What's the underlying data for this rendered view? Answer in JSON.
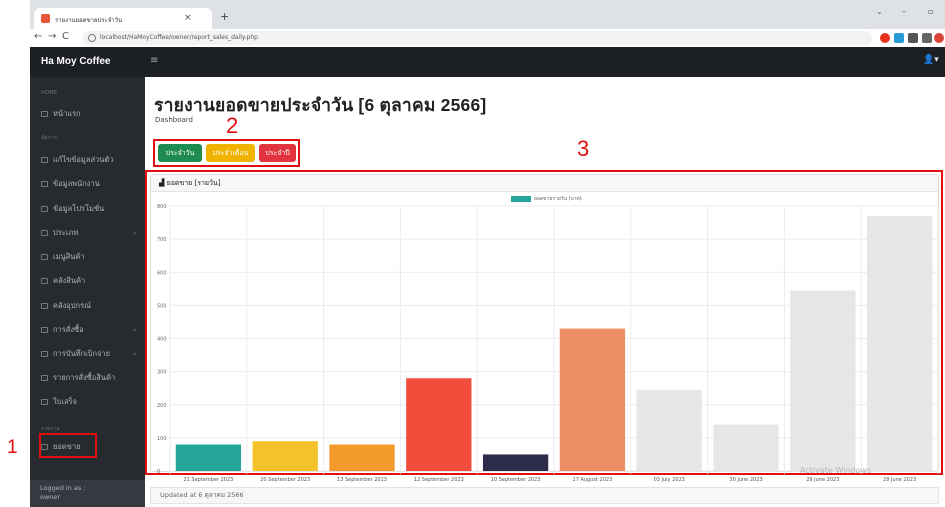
{
  "browser": {
    "tab_title": "รายงานยอดขายประจำวัน",
    "tab_close": "×",
    "new_tab": "+",
    "url": "localhost/HaMoyCoffee/owner/report_sales_daily.php"
  },
  "sidebar": {
    "brand": "Ha Moy Coffee",
    "sections": {
      "home": "HOME",
      "manage": "จัดการ",
      "report": "รายงาน"
    },
    "items": [
      {
        "label": "หน้าแรก",
        "icon": "home-icon",
        "chevron": false
      },
      {
        "label": "แก้ไขข้อมูลส่วนตัว",
        "icon": "user-edit-icon",
        "chevron": false
      },
      {
        "label": "ข้อมูลพนักงาน",
        "icon": "users-icon",
        "chevron": false
      },
      {
        "label": "ข้อมูลโปรโมชั่น",
        "icon": "promo-icon",
        "chevron": false
      },
      {
        "label": "ประเภท",
        "icon": "category-icon",
        "chevron": true
      },
      {
        "label": "เมนูสินค้า",
        "icon": "coffee-icon",
        "chevron": false
      },
      {
        "label": "คลังสินค้า",
        "icon": "box-icon",
        "chevron": false
      },
      {
        "label": "คลังอุปกรณ์",
        "icon": "tools-icon",
        "chevron": false
      },
      {
        "label": "การสั่งซื้อ",
        "icon": "cart-icon",
        "chevron": true
      },
      {
        "label": "การบันทึกเบิกจ่าย",
        "icon": "withdraw-icon",
        "chevron": true
      },
      {
        "label": "รายการสั่งซื้อสินค้า",
        "icon": "list-icon",
        "chevron": false
      },
      {
        "label": "ใบเสร็จ",
        "icon": "receipt-icon",
        "chevron": false
      },
      {
        "label": "ยอดขาย",
        "icon": "chart-icon",
        "chevron": false
      }
    ],
    "footer": {
      "line1": "Logged in as :",
      "line2": "owner"
    }
  },
  "annotations": {
    "one": "1",
    "two": "2",
    "three": "3"
  },
  "page": {
    "title": "รายงานยอดขายประจำวัน [6 ตุลาคม 2566]",
    "breadcrumb": "Dashboard",
    "buttons": {
      "daily": "ประจำวัน",
      "monthly": "ประจำเดือน",
      "yearly": "ประจำปี"
    },
    "card_title": "ยอดขาย [รายวัน]",
    "updated": "Updated at 6 ตุลาคม 2566",
    "watermark": "Activate Windows"
  },
  "colors": {
    "daily_btn": "#1e8c4e",
    "monthly_btn": "#f0b400",
    "yearly_btn": "#e2343f",
    "annotation": "#e01010"
  },
  "chart_data": {
    "type": "bar",
    "legend": "ยอดขายรายวัน (บาท)",
    "categories": [
      "21 September 2023",
      "20 September 2023",
      "13 September 2023",
      "12 September 2023",
      "10 September 2023",
      "17 August 2023",
      "03 July 2023",
      "30 June 2023",
      "29 June 2023",
      "28 June 2023"
    ],
    "values": [
      80,
      90,
      80,
      280,
      50,
      430,
      245,
      140,
      545,
      770
    ],
    "colors": [
      "#26a69a",
      "#f4c22b",
      "#f39c2d",
      "#f24d3c",
      "#2c2c4a",
      "#ee8e66",
      "#e6e6e6",
      "#e6e6e6",
      "#e6e6e6",
      "#e6e6e6"
    ],
    "ylim": [
      0,
      800
    ],
    "yticks": [
      0,
      100,
      200,
      300,
      400,
      500,
      600,
      700,
      800
    ],
    "grid": true,
    "legend_position": "top"
  }
}
